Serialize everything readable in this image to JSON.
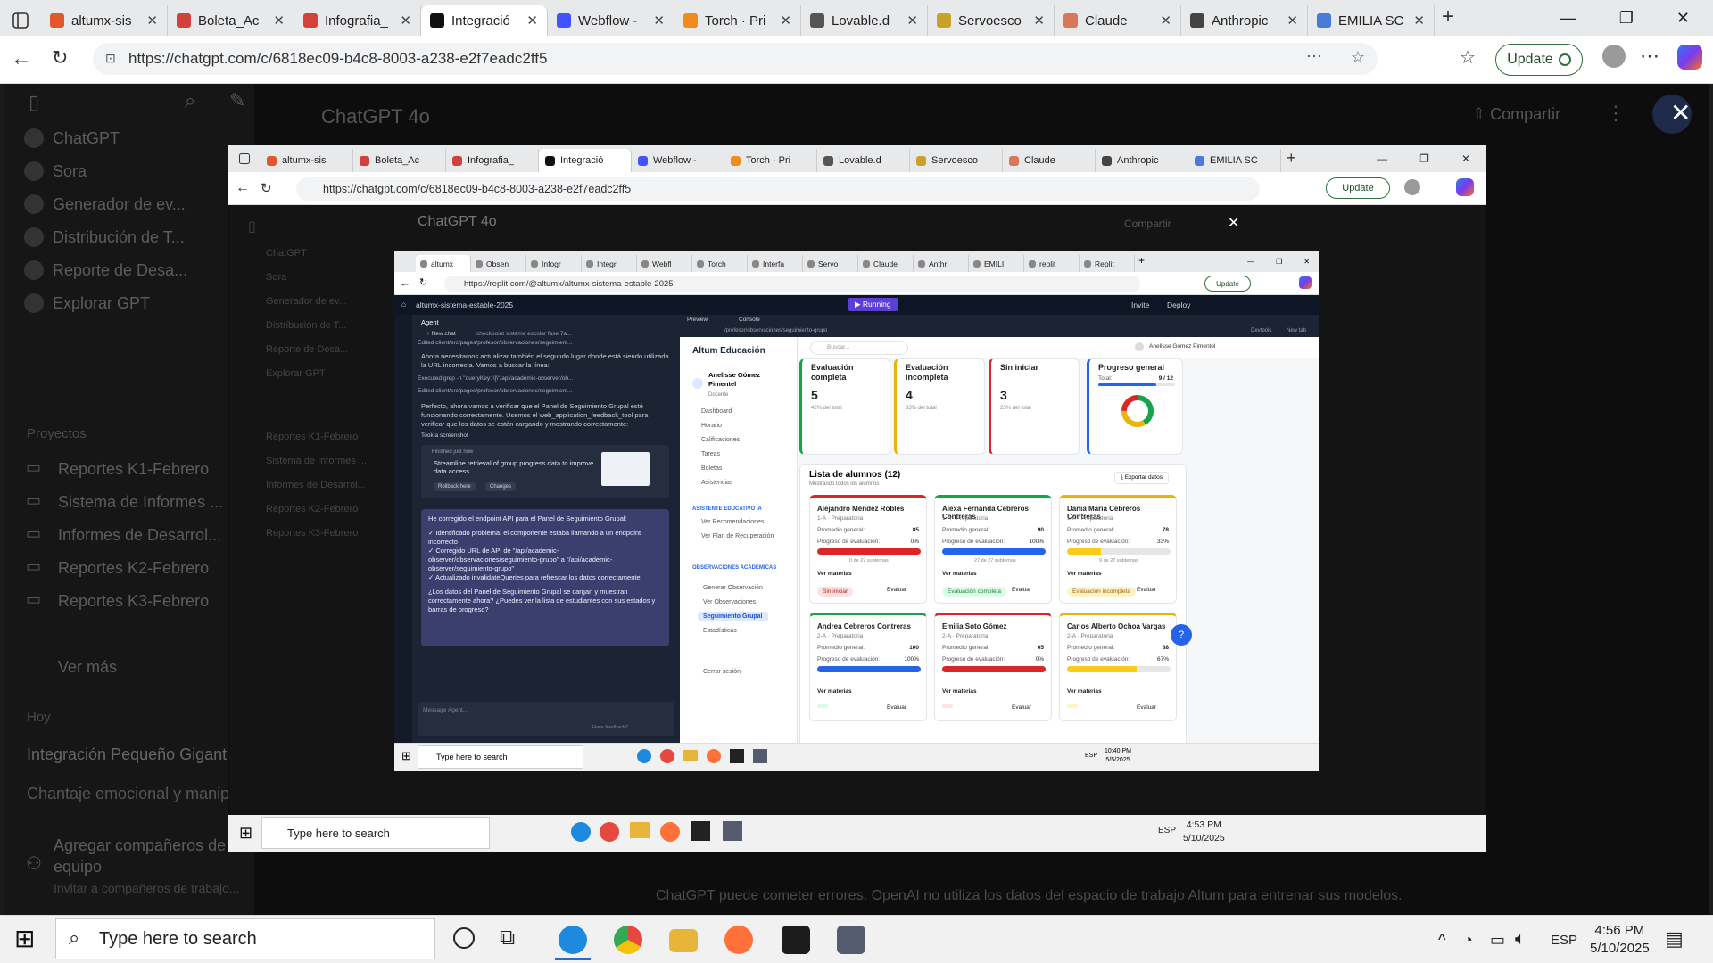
{
  "browser": {
    "tabs": [
      {
        "label": "altumx-sis",
        "color": "#e2572b"
      },
      {
        "label": "Boleta_Ac",
        "color": "#d2423c"
      },
      {
        "label": "Infografia_",
        "color": "#d2423c"
      },
      {
        "label": "Integració",
        "color": "#111111",
        "active": true
      },
      {
        "label": "Webflow -",
        "color": "#4353ff"
      },
      {
        "label": "Torch · Pri",
        "color": "#f08b1d"
      },
      {
        "label": "Lovable.d",
        "color": "#555555"
      },
      {
        "label": "Servoesco",
        "color": "#c9a227"
      },
      {
        "label": "Claude",
        "color": "#d9775b"
      },
      {
        "label": "Anthropic",
        "color": "#444444"
      },
      {
        "label": "EMILIA SC",
        "color": "#4a7bd8"
      }
    ],
    "url": "https://chatgpt.com/c/6818ec09-b4c8-8003-a238-e2f7eadc2ff5",
    "update_label": "Update"
  },
  "chatgpt": {
    "title": "ChatGPT 4o",
    "share_label": "Compartir",
    "sidebar": {
      "items": [
        "ChatGPT",
        "Sora",
        "Generador de ev...",
        "Distribución de T...",
        "Reporte de Desa...",
        "Explorar GPT"
      ],
      "projects_header": "Proyectos",
      "projects": [
        "Reportes K1-Febrero",
        "Sistema de Informes ...",
        "Informes de Desarrol...",
        "Reportes K2-Febrero",
        "Reportes K3-Febrero"
      ],
      "more": "Ver más",
      "today_header": "Hoy",
      "chats": [
        "Integración Pequeño Gigante",
        "Chantaje emocional y manip..."
      ],
      "add_team": "Agregar compañeros de equipo",
      "invite": "Invitar a compañeros de trabajo..."
    },
    "footer": "ChatGPT puede cometer errores. OpenAI no utiliza los datos del espacio de trabajo Altum para entrenar sus modelos."
  },
  "taskbar": {
    "search_placeholder": "Type here to search",
    "lang": "ESP",
    "time": "4:56 PM",
    "date": "5/10/2025"
  },
  "level2": {
    "url": "https://chatgpt.com/c/6818ec09-b4c8-8003-a238-e2f7eadc2ff5",
    "time": "4:53 PM",
    "date": "5/10/2025",
    "search_placeholder": "Type here to search",
    "lang": "ESP"
  },
  "level3": {
    "tabs": [
      "altumx",
      "Obsen",
      "Infogr",
      "Integr",
      "Webfl",
      "Torch",
      "Interfa",
      "Servo",
      "Claude",
      "Anthr",
      "EMILI",
      "replit",
      "Replit"
    ],
    "url": "https://replit.com/@altumx/altumx-sistema-estable-2025",
    "repl_name": "altumx-sistema-estable-2025",
    "running": "Running",
    "invite": "Invite",
    "deploy": "Deploy",
    "agent_tab": "Agent",
    "new_chat": "+ New chat",
    "checkpoint": "checkpoint sistema escolar fase 7a...",
    "edited1": "Edited client/src/pages/profesor/observaciones/seguimient...",
    "msg1": "Ahora necesitamos actualizar también el segundo lugar donde está siendo utilizada la URL incorrecta. Vamos a buscar la línea:",
    "executed": "Executed grep -n \"queryKey: \\[\\\"/api/academic-observer/ob...",
    "edited2": "Edited client/src/pages/profesor/observaciones/seguimient...",
    "msg2": "Perfecto, ahora vamos a verificar que el Panel de Seguimiento Grupal esté funcionando correctamente. Usemos el web_application_feedback_tool para verificar que los datos se están cargando y mostrando correctamente:",
    "screenshot": "Took a screenshot",
    "finished": "Finished just now",
    "streamline": "Streamline retrieval of group progress data to improve data access",
    "rollback": "Rollback here",
    "changes": "Changes",
    "summary_title": "He corregido el endpoint API para el Panel de Seguimiento Grupal:",
    "summary_items": [
      "✓ Identificado problema: el componente estaba llamando a un endpoint incorrecto",
      "✓ Corregido URL de API de \"/api/academic-observer/observaciones/seguimiento-grupo\" a \"/api/academic-observer/seguimiento-grupo\"",
      "✓ Actualizado invalidateQueries para refrescar los datos correctamente"
    ],
    "summary_q": "¿Los datos del Panel de Seguimiento Grupal se cargan y muestran correctamente ahora? ¿Puedes ver la lista de estudiantes con sus estados y barras de progreso?",
    "message_placeholder": "Message Agent...",
    "feedback": "Have feedback?",
    "preview_tab": "Preview",
    "console_tab": "Console",
    "preview_url": "/profesor/observaciones/seguimiento-grupo",
    "devtools": "Devtools",
    "newtab": "New tab",
    "time": "10:40 PM",
    "date": "5/5/2025",
    "search_placeholder": "Type here to search",
    "lang": "ESP"
  },
  "app": {
    "brand": "Altum Educación",
    "search_placeholder": "Buscar...",
    "user_name": "Anelisse Gómez Pimentel",
    "profile_name": "Anelisse Gómez Pimentel",
    "profile_role": "Docente",
    "nav": [
      "Dashboard",
      "Horario",
      "Calificaciones",
      "Tareas",
      "Boletas",
      "Asistencias"
    ],
    "section_ai": "ASISTENTE EDUCATIVO IA",
    "ai_items": [
      "Ver Recomendaciones",
      "Ver Plan de Recuperación"
    ],
    "section_obs": "OBSERVACIONES ACADÉMICAS",
    "obs_items": [
      "Generar Observación",
      "Ver Observaciones",
      "Seguimiento Grupal",
      "Estadísticas"
    ],
    "logout": "Cerrar sesión",
    "stats": [
      {
        "title": "Evaluación completa",
        "value": "5",
        "sub": "42% del total",
        "color": "#16a34a"
      },
      {
        "title": "Evaluación incompleta",
        "value": "4",
        "sub": "33% del total",
        "color": "#eab308"
      },
      {
        "title": "Sin iniciar",
        "value": "3",
        "sub": "25% del total",
        "color": "#dc2626"
      }
    ],
    "progress": {
      "title": "Progreso general",
      "total_label": "Total:",
      "value": "9 / 12",
      "fraction": 0.75
    },
    "list_title": "Lista de alumnos (12)",
    "list_sub": "Mostrando todos los alumnos",
    "export": "Exportar datos",
    "avg_label": "Promedio general:",
    "progress_label": "Progreso de evaluación:",
    "see_subjects": "Ver materias",
    "evaluate": "Evaluar",
    "students": [
      {
        "name": "Alejandro Méndez Robles",
        "group": "1-A · Preparatoria",
        "avg": "85",
        "pct": "0%",
        "fraction": 0.0,
        "sub": "0 de 27 subtemas",
        "status": "Sin iniciar",
        "bar": "#dc2626",
        "pillbg": "#fde2e2",
        "pillfg": "#b91c1c",
        "top": "#dc2626"
      },
      {
        "name": "Alexa Fernanda Cebreros Contreras",
        "group": "1-A · Preparatoria",
        "avg": "90",
        "pct": "100%",
        "fraction": 1.0,
        "sub": "27 de 27 subtemas",
        "status": "Evaluación completa",
        "bar": "#2563eb",
        "pillbg": "#dcfce7",
        "pillfg": "#15803d",
        "top": "#16a34a"
      },
      {
        "name": "Dania María Cebreros Contreras",
        "group": "1-A · Preparatoria",
        "avg": "78",
        "pct": "33%",
        "fraction": 0.33,
        "sub": "9 de 27 subtemas",
        "status": "Evaluación incompleta",
        "bar": "#facc15",
        "pillbg": "#fef3c7",
        "pillfg": "#a16207",
        "top": "#eab308"
      },
      {
        "name": "Andrea Cebreros Contreras",
        "group": "2-A · Preparatoria",
        "avg": "100",
        "pct": "100%",
        "fraction": 1.0,
        "sub": "",
        "status": "",
        "bar": "#2563eb",
        "pillbg": "#dcfce7",
        "pillfg": "#15803d",
        "top": "#16a34a"
      },
      {
        "name": "Emilia Soto Gómez",
        "group": "2-A · Preparatoria",
        "avg": "65",
        "pct": "0%",
        "fraction": 0.0,
        "sub": "",
        "status": "",
        "bar": "#dc2626",
        "pillbg": "#fde2e2",
        "pillfg": "#b91c1c",
        "top": "#dc2626"
      },
      {
        "name": "Carlos Alberto Ochoa Vargas",
        "group": "2-A · Preparatoria",
        "avg": "88",
        "pct": "67%",
        "fraction": 0.67,
        "sub": "",
        "status": "",
        "bar": "#facc15",
        "pillbg": "#fef3c7",
        "pillfg": "#a16207",
        "top": "#eab308"
      }
    ]
  }
}
